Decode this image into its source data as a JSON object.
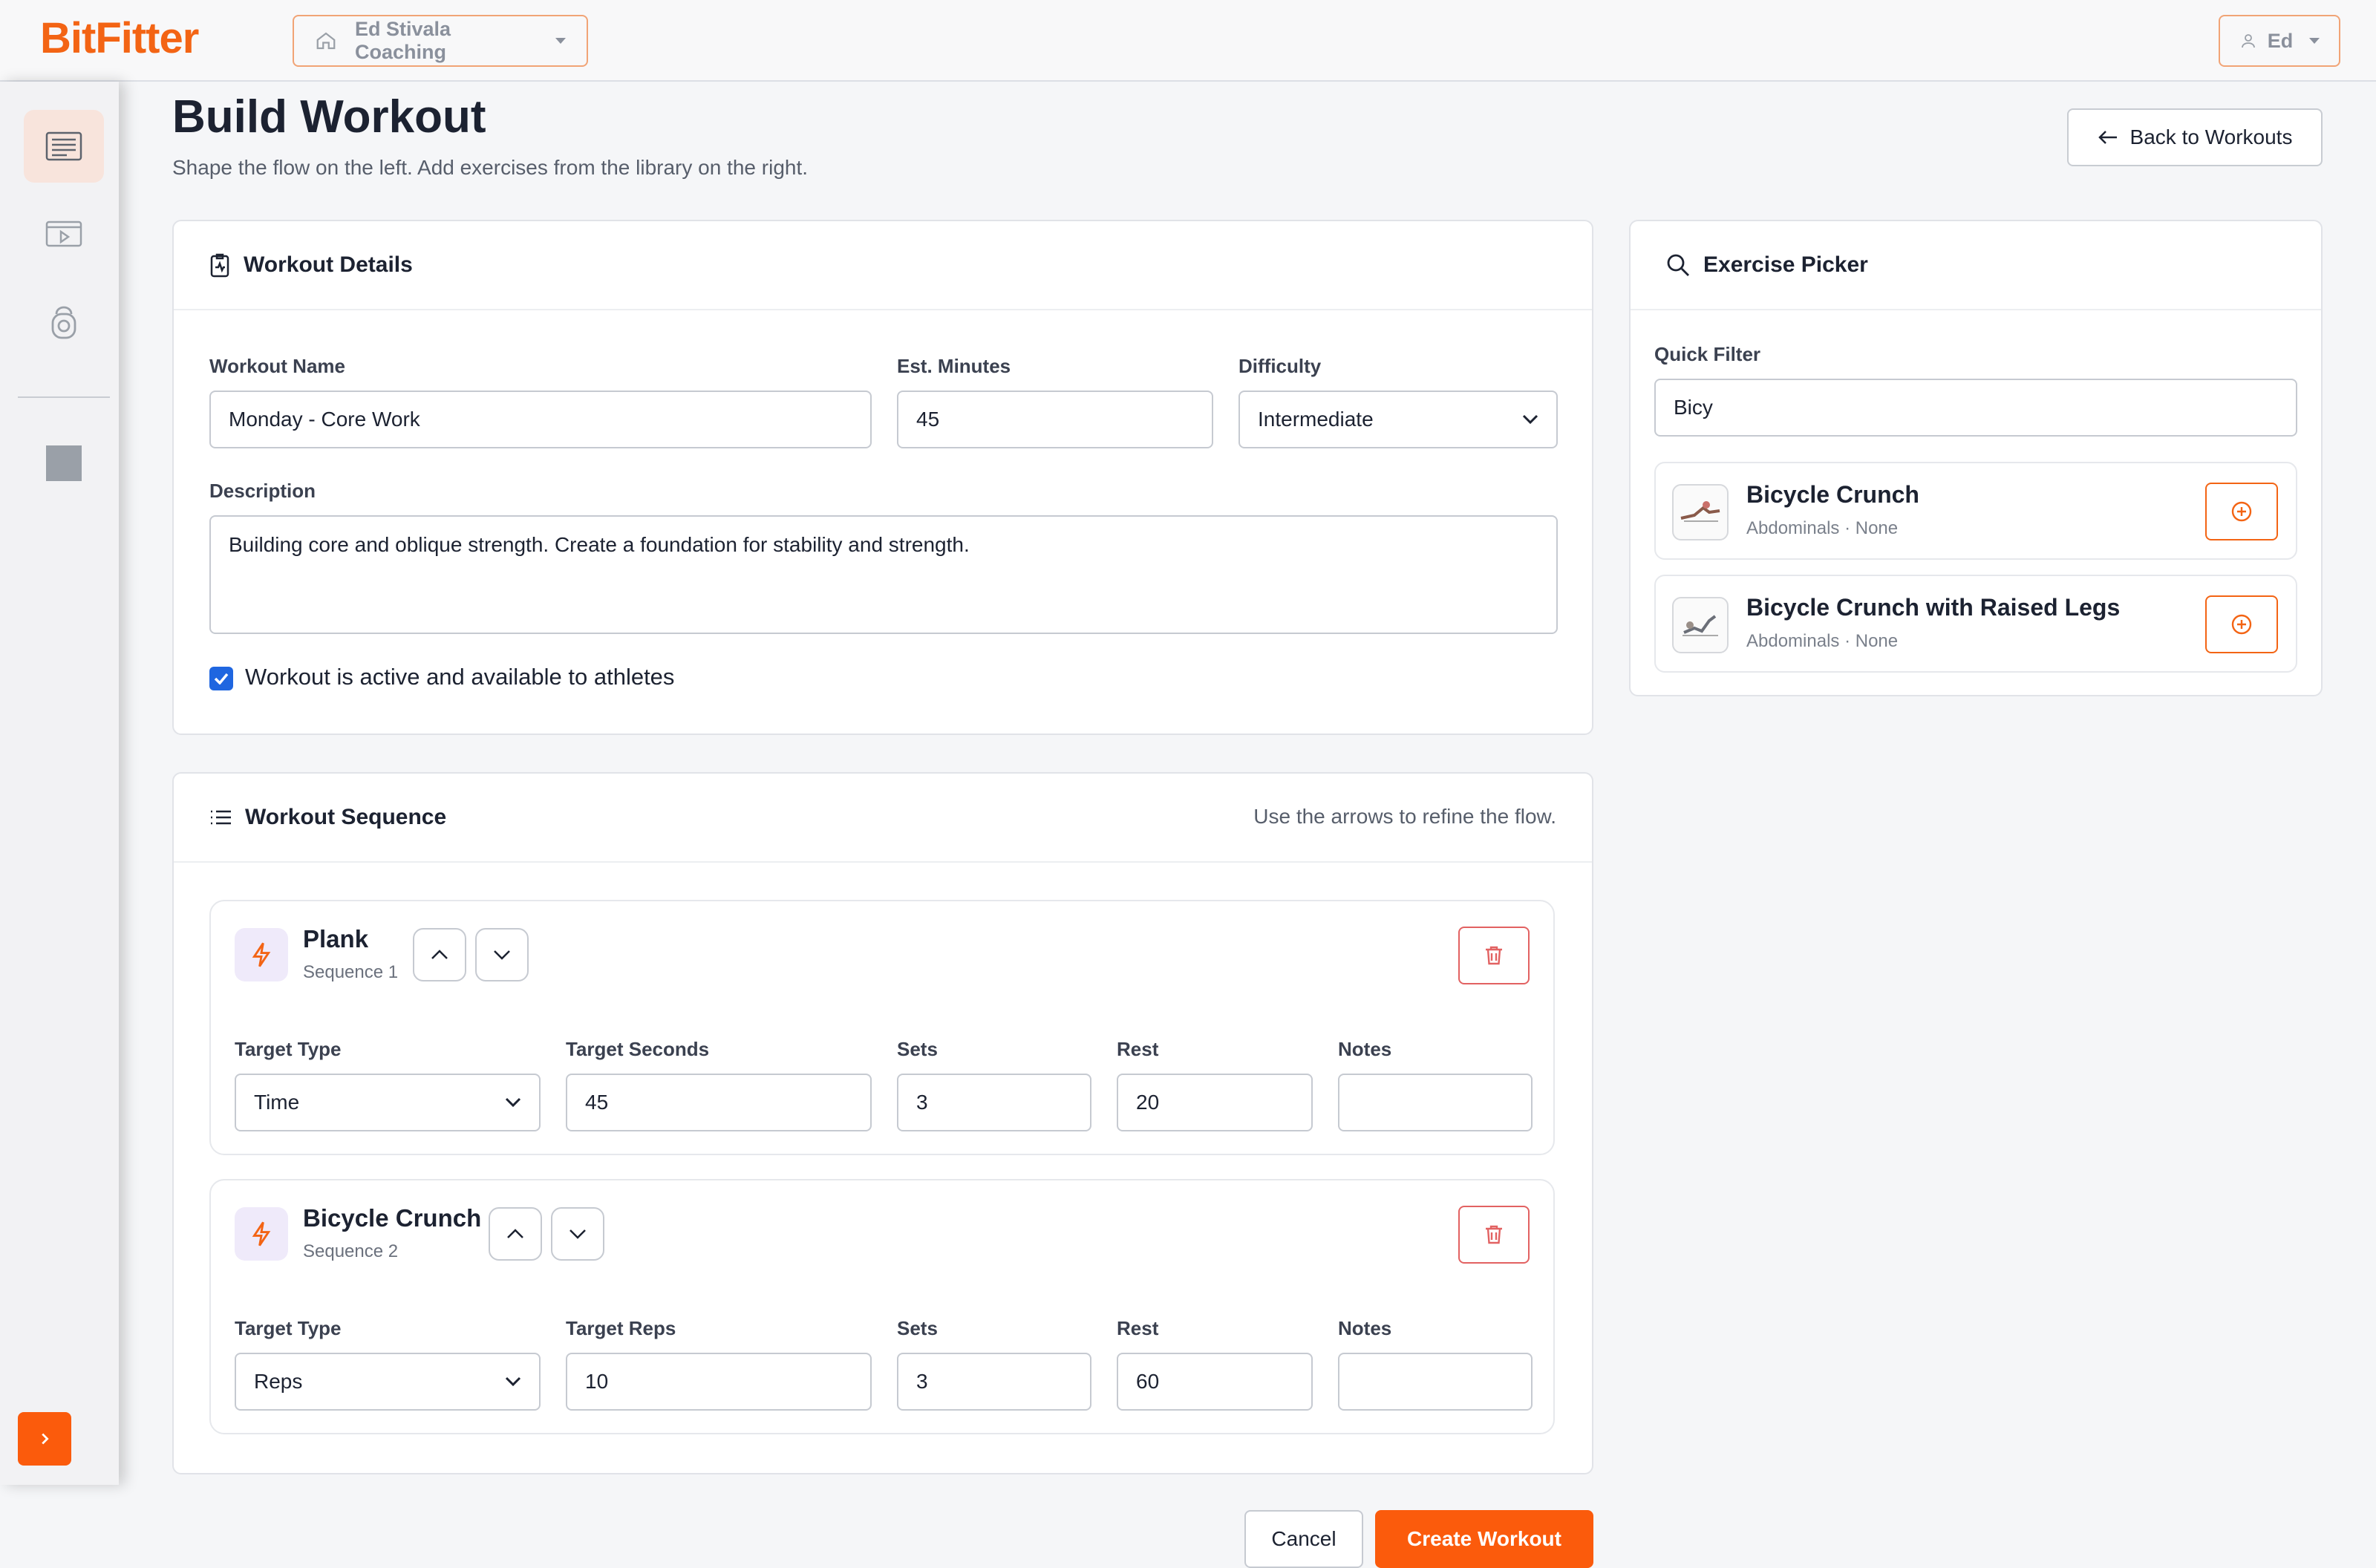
{
  "app": {
    "logo": "BitFitter"
  },
  "topbar": {
    "org_name": "Ed Stivala Coaching",
    "user_name": "Ed"
  },
  "sidebar": {
    "items": [
      {
        "icon": "workouts-list-icon",
        "active": true
      },
      {
        "icon": "video-library-icon",
        "active": false
      },
      {
        "icon": "kettlebell-icon",
        "active": false
      }
    ]
  },
  "page": {
    "title": "Build Workout",
    "subtitle": "Shape the flow on the left. Add exercises from the library on the right.",
    "back_label": "Back to Workouts"
  },
  "details": {
    "header": "Workout Details",
    "name_label": "Workout Name",
    "name_value": "Monday - Core Work",
    "minutes_label": "Est. Minutes",
    "minutes_value": "45",
    "difficulty_label": "Difficulty",
    "difficulty_value": "Intermediate",
    "description_label": "Description",
    "description_value": "Building core and oblique strength. Create a foundation for stability and strength.",
    "active_checked": true,
    "active_label": "Workout is active and available to athletes"
  },
  "sequence": {
    "header": "Workout Sequence",
    "hint": "Use the arrows to refine the flow.",
    "items": [
      {
        "name": "Plank",
        "sequence_label": "Sequence 1",
        "target_type_label": "Target Type",
        "target_type_value": "Time",
        "target_label": "Target Seconds",
        "target_value": "45",
        "sets_label": "Sets",
        "sets_value": "3",
        "rest_label": "Rest",
        "rest_value": "20",
        "notes_label": "Notes",
        "notes_value": ""
      },
      {
        "name": "Bicycle Crunch",
        "sequence_label": "Sequence 2",
        "target_type_label": "Target Type",
        "target_type_value": "Reps",
        "target_label": "Target Reps",
        "target_value": "10",
        "sets_label": "Sets",
        "sets_value": "3",
        "rest_label": "Rest",
        "rest_value": "60",
        "notes_label": "Notes",
        "notes_value": ""
      }
    ]
  },
  "picker": {
    "header": "Exercise Picker",
    "filter_label": "Quick Filter",
    "filter_value": "Bicy",
    "results": [
      {
        "name": "Bicycle Crunch",
        "meta": "Abdominals · None"
      },
      {
        "name": "Bicycle Crunch with Raised Legs",
        "meta": "Abdominals · None"
      }
    ]
  },
  "actions": {
    "cancel_label": "Cancel",
    "create_label": "Create Workout"
  },
  "colors": {
    "accent": "#fb5b0c",
    "danger": "#e26262",
    "checkbox": "#1f66e0"
  }
}
